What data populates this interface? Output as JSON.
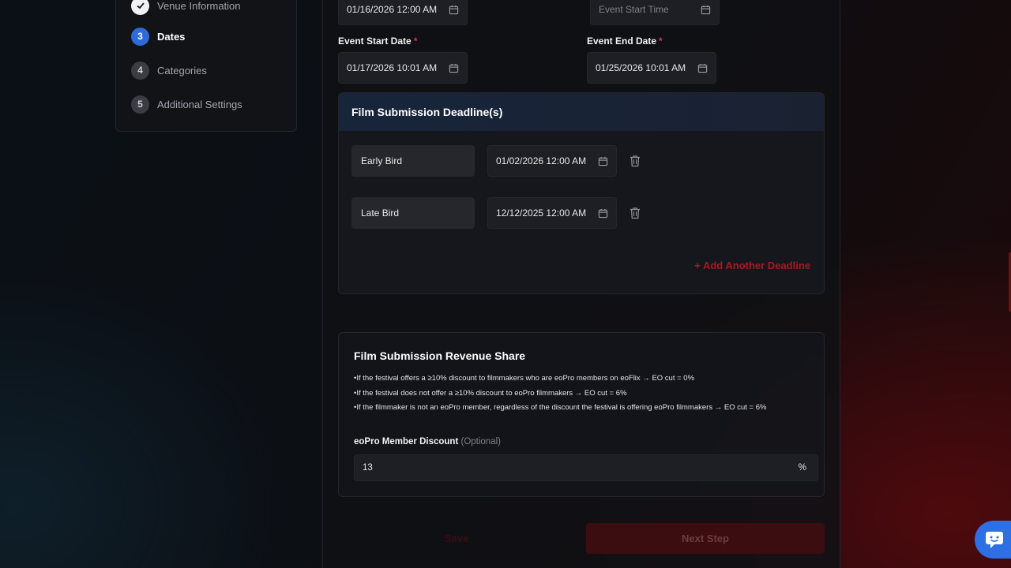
{
  "stepper": {
    "steps": [
      {
        "number": "",
        "label": "Venue Information",
        "state": "done"
      },
      {
        "number": "3",
        "label": "Dates",
        "state": "active"
      },
      {
        "number": "4",
        "label": "Categories",
        "state": "upcoming"
      },
      {
        "number": "5",
        "label": "Additional Settings",
        "state": "upcoming"
      }
    ]
  },
  "top_row": {
    "left_value": "01/16/2026 12:00 AM",
    "right_placeholder": "Event Start Time"
  },
  "event_dates": {
    "start_label": "Event Start Date",
    "start_value": "01/17/2026 10:01 AM",
    "end_label": "Event End Date",
    "end_value": "01/25/2026 10:01 AM",
    "required_mark": "*"
  },
  "deadlines": {
    "title": "Film Submission Deadline(s)",
    "items": [
      {
        "name": "Early Bird",
        "date": "01/02/2026 12:00 AM"
      },
      {
        "name": "Late Bird",
        "date": "12/12/2025 12:00 AM"
      }
    ],
    "add_label": "+ Add Another Deadline"
  },
  "revenue": {
    "title": "Film Submission Revenue Share",
    "rules": [
      "If the festival offers a ≥10% discount to filmmakers who are eoPro members on eoFlix → EO cut = 0%",
      "If the festival does not offer a ≥10% discount to eoPro filmmakers → EO cut = 6%",
      "If the filmmaker is not an eoPro member, regardless of the discount the festival is offering eoPro filmmakers → EO cut = 6%"
    ],
    "discount_label": "eoPro Member Discount",
    "discount_optional": "(Optional)",
    "discount_value": "13",
    "discount_unit": "%"
  },
  "actions": {
    "save_label": "Save",
    "next_label": "Next Step"
  },
  "colors": {
    "accent_blue": "#2e6bd8",
    "accent_red": "#a81a22",
    "chat_blue": "#2f6fe4"
  }
}
